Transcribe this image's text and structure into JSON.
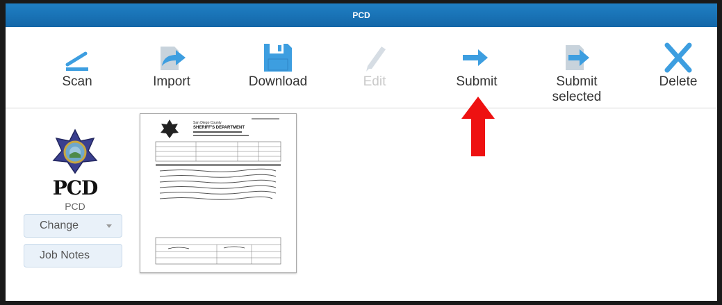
{
  "window": {
    "title": "PCD"
  },
  "toolbar": {
    "scan": "Scan",
    "import": "Import",
    "download": "Download",
    "edit": "Edit",
    "submit": "Submit",
    "submit_selected_line1": "Submit",
    "submit_selected_line2": "selected",
    "delete": "Delete"
  },
  "sidebar": {
    "logo_text": "PCD",
    "profile_name": "PCD",
    "change_label": "Change",
    "job_notes_label": "Job Notes"
  },
  "thumbnail": {
    "header_line1": "San Diego County",
    "header_line2": "SHERIFF'S DEPARTMENT"
  },
  "colors": {
    "titlebar": "#1a74b9",
    "icon_blue": "#3d9ee0",
    "icon_gray": "#c8d3dc",
    "button_bg": "#e9f1f9",
    "callout_arrow": "#ee1111"
  }
}
